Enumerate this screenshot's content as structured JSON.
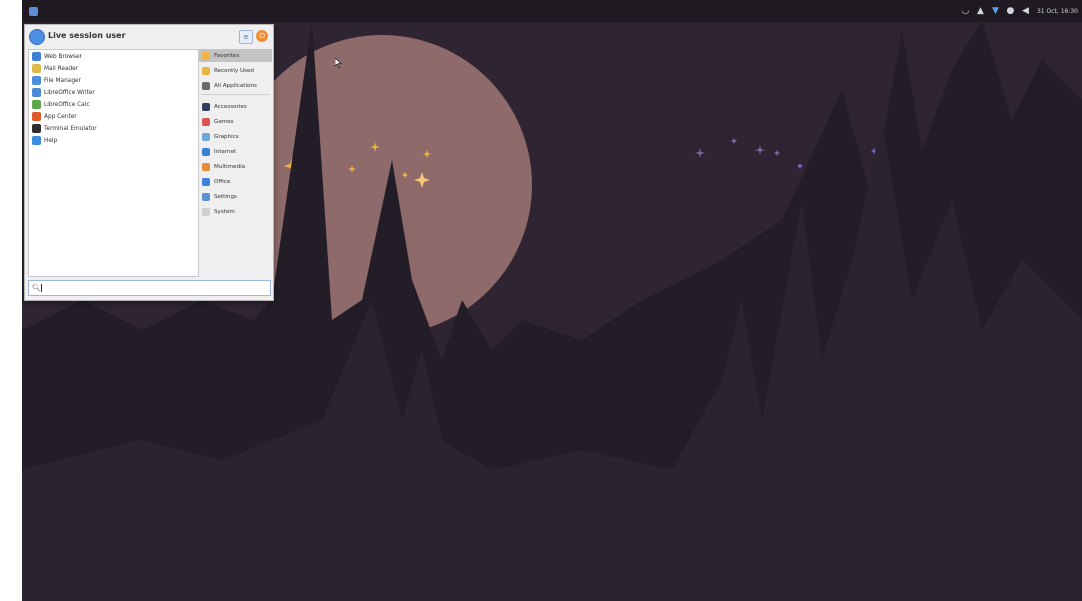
{
  "panel": {
    "clock": "31 Oct, 16:30",
    "tray_icons": [
      "wifi-icon",
      "bell-icon",
      "network-icon",
      "disk-icon",
      "volume-icon"
    ]
  },
  "whisker": {
    "user": "Live session user",
    "apps": [
      {
        "label": "Web Browser",
        "icon": "globe-icon",
        "color": "#3e7fd6"
      },
      {
        "label": "Mail Reader",
        "icon": "mail-icon",
        "color": "#e0b94f"
      },
      {
        "label": "File Manager",
        "icon": "folder-icon",
        "color": "#4a8fd9"
      },
      {
        "label": "LibreOffice Writer",
        "icon": "writer-icon",
        "color": "#4a8ad7"
      },
      {
        "label": "LibreOffice Calc",
        "icon": "calc-icon",
        "color": "#5ca84a"
      },
      {
        "label": "App Center",
        "icon": "app-center-icon",
        "color": "#e05a2b"
      },
      {
        "label": "Terminal Emulator",
        "icon": "terminal-icon",
        "color": "#2e2e2e"
      },
      {
        "label": "Help",
        "icon": "help-icon",
        "color": "#3b8be0"
      }
    ],
    "categories_top": [
      {
        "label": "Favorites",
        "icon": "star-icon",
        "color": "#f0b541",
        "selected": true
      },
      {
        "label": "Recently Used",
        "icon": "clock-icon",
        "color": "#e8b43c",
        "selected": false
      },
      {
        "label": "All Applications",
        "icon": "apps-icon",
        "color": "#6a6a6a",
        "selected": false
      }
    ],
    "categories": [
      {
        "label": "Accessories",
        "icon": "accessories-icon",
        "color": "#2f3f5a"
      },
      {
        "label": "Games",
        "icon": "games-icon",
        "color": "#d9534f"
      },
      {
        "label": "Graphics",
        "icon": "graphics-icon",
        "color": "#6fa8d8"
      },
      {
        "label": "Internet",
        "icon": "internet-icon",
        "color": "#3b7fd4"
      },
      {
        "label": "Multimedia",
        "icon": "multimedia-icon",
        "color": "#e98b3a"
      },
      {
        "label": "Office",
        "icon": "office-icon",
        "color": "#3f7fd9"
      },
      {
        "label": "Settings",
        "icon": "settings-icon",
        "color": "#5b8fd6"
      },
      {
        "label": "System",
        "icon": "system-icon",
        "color": "#d0d0d0"
      }
    ],
    "search_placeholder": ""
  },
  "colors": {
    "sky": "#2f2532",
    "moon": "#8e6a6a",
    "mountain": "#1f1a24",
    "star_gold": "#f0b541",
    "star_purple": "#8d5ccf"
  }
}
